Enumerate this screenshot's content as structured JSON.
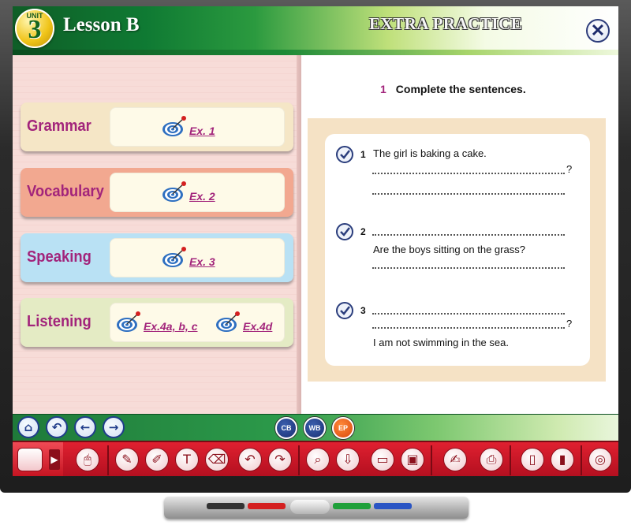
{
  "header": {
    "unit_label": "UNIT",
    "unit_number": "3",
    "lesson_title": "Lesson B",
    "section_title": "EXTRA PRACTICE",
    "close_icon": "close-icon"
  },
  "categories": [
    {
      "label": "Grammar",
      "links": [
        "Ex. 1"
      ],
      "color": "#f5e6c6"
    },
    {
      "label": "Vocabulary",
      "links": [
        "Ex. 2"
      ],
      "color": "#f2a890"
    },
    {
      "label": "Speaking",
      "links": [
        "Ex. 3"
      ],
      "color": "#b9e1f4"
    },
    {
      "label": "Listening",
      "links": [
        "Ex.4a, b, c",
        "Ex.4d"
      ],
      "color": "#e4ebc4"
    }
  ],
  "exercise": {
    "number": "1",
    "instruction": "Complete the sentences.",
    "items": [
      {
        "num": "1",
        "sentence": "The girl is baking a cake.",
        "qmark": "?"
      },
      {
        "num": "2",
        "sentence": "Are the boys sitting on the grass?"
      },
      {
        "num": "3",
        "sentence": "I am not swimming in the sea.",
        "qmark": "?"
      }
    ]
  },
  "nav": {
    "buttons": [
      "home-icon",
      "back-curve-icon",
      "arrow-left-icon",
      "arrow-right-icon"
    ],
    "books": [
      "CB",
      "WB",
      "EP"
    ]
  },
  "toolbar": {
    "icons": [
      "window-icon",
      "expand-arrow-icon",
      "mouse-icon",
      "pencil-icon",
      "highlighter-icon",
      "text-icon",
      "eraser-icon",
      "undo-icon",
      "redo-icon",
      "zoom-icon",
      "download-icon",
      "screen-icon",
      "screen-edit-icon",
      "notepad-icon",
      "printer-icon",
      "usb-icon",
      "usb-save-icon",
      "globe-icon"
    ]
  },
  "colors": {
    "accent_magenta": "#a2247b",
    "header_green": "#0f7a33",
    "toolbar_red": "#c4121f",
    "nav_blue": "#1f3c8a"
  }
}
